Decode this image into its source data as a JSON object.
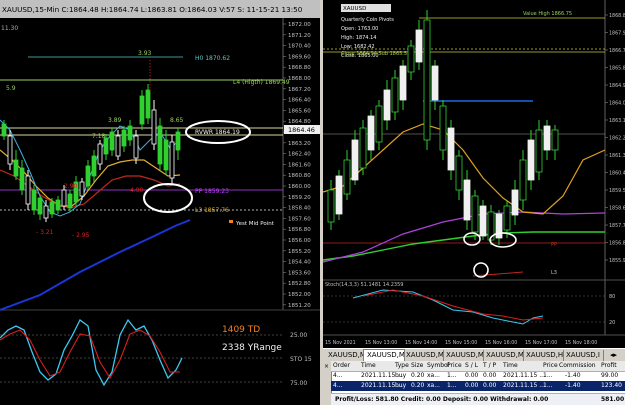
{
  "left_chart": {
    "header": "XAUUSD,15-Min  C:1864.48  H:1864.74 L:1863.81  O:1864.03  V:57  S:  11-15-21  13:50",
    "y_ticks": [
      "1872.00",
      "1871.20",
      "1870.40",
      "1869.60",
      "1868.80",
      "1868.00",
      "1867.20",
      "1866.40",
      "1865.60",
      "1864.80",
      "1864.00",
      "1863.20",
      "1862.40",
      "1861.60",
      "1860.80",
      "1860.00",
      "1859.20",
      "1858.40",
      "1857.60",
      "1856.80",
      "1856.00",
      "1855.20",
      "1854.40",
      "1853.60",
      "1852.80",
      "1852.00",
      "1851.20"
    ],
    "price_box": "1864.46",
    "labels": {
      "h0": "H0 1870.62",
      "l4": "L4 (Higth) 1869.49",
      "rvwr": "RVWR 1864.19",
      "pp": "PP 1859.23",
      "l3": "L3 1857.76",
      "yest_mid": "Yest Mid Point",
      "lbl_393": "3.93",
      "lbl_389": "3.89",
      "lbl_865": "8.65",
      "lbl_718": "7.18",
      "lbl_290": "2.90",
      "lbl_490": "4.90",
      "lbl_minus321": "- 3.21",
      "lbl_minus295": "- 2.95",
      "lbl_5": "5.9"
    },
    "left_time": "11.30"
  },
  "stoch_panel": {
    "td_text": "1409 TD",
    "yrange_text": "2338 YRange",
    "y_labels": [
      "25.00",
      "STO 15",
      "75.00"
    ]
  },
  "right_chart": {
    "title_box": "XAUUSD",
    "info_lines": [
      "Quarterly Coin Pivots",
      "Open: 1763.00",
      "High: 1874.14",
      "Low: 1682.42",
      "Close: 1865.00"
    ],
    "top_label": "Value High 1866.75",
    "line_label": "Close 1864.94 Sub 1865.52",
    "y_ticks": [
      "1868.80",
      "1867.90",
      "1866.70",
      "1865.80",
      "1864.90",
      "1864.00",
      "1863.10",
      "1862.20",
      "1861.30",
      "1860.40",
      "1859.50",
      "1858.60",
      "1857.70",
      "1856.80",
      "1855.90"
    ],
    "right_labels": [
      "PP",
      "L3"
    ],
    "stoch_label": "Stoch(14,3,3) 51.1481 14.2359",
    "stoch_ticks": [
      "80",
      "20"
    ],
    "time_labels": [
      "15 Nov 2021",
      "15 Nov 13:00",
      "15 Nov 14:00",
      "15 Nov 15:00",
      "15 Nov 16:00",
      "15 Nov 17:00",
      "15 Nov 18:00"
    ]
  },
  "tabs": [
    "XAUUSD,M15",
    "XAUUSD,M15",
    "XAUUSD,M15",
    "XAUUSD,M15",
    "XAUUSD,M15",
    "XAUUSD,H4",
    "XAUUSD,I"
  ],
  "terminal": {
    "columns": [
      "Order",
      "Time",
      "Type",
      "Size",
      "Symbol",
      "Price",
      "S / L",
      "T / P",
      "Time",
      "Price",
      "Commission",
      "Profit"
    ],
    "rows": [
      [
        "4...",
        "2021.11.15 ...",
        "buy",
        "0.20",
        "xa...",
        "1...",
        "0.00",
        "0.00",
        "2021.11.15 ...",
        "1...",
        "-1.40",
        "99.00"
      ],
      [
        "4...",
        "2021.11.15 ...",
        "buy",
        "0.20",
        "xa...",
        "1...",
        "0.00",
        "0.00",
        "2021.11.15 ...",
        "1...",
        "-1.40",
        "123.40"
      ]
    ],
    "summary": "Profit/Loss: 581.80  Credit: 0.00  Deposit: 0.00  Withdrawal: 0.00",
    "total": "581.00"
  },
  "colors": {
    "background": "#000000",
    "yellow_line": "#c8c832",
    "blue_line": "#1a36d8",
    "red_line": "#c0281c",
    "stoch_cyan": "#3cc8f0",
    "stoch_red": "#d82020",
    "td_orange": "#f08020",
    "pivot_purple": "#c040ff"
  }
}
